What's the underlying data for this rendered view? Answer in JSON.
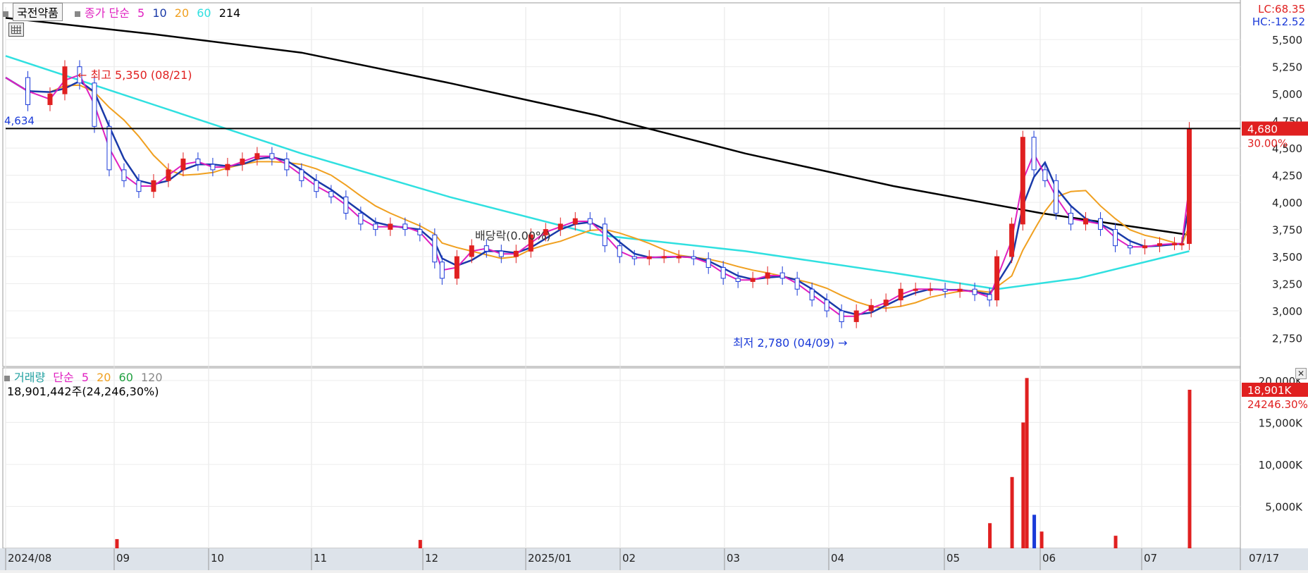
{
  "legend": {
    "stock_name": "국전약품",
    "price_label": "종가 단순",
    "price_ma": [
      {
        "label": "5",
        "color": "#e020c0"
      },
      {
        "label": "10",
        "color": "#1a3aa8"
      },
      {
        "label": "20",
        "color": "#f0a020"
      },
      {
        "label": "60",
        "color": "#30e0e0"
      },
      {
        "label": "214",
        "color": "#000000"
      }
    ],
    "volume_label": "거래량",
    "volume_simple": "단순",
    "volume_ma": [
      {
        "label": "5",
        "color": "#e020c0"
      },
      {
        "label": "20",
        "color": "#f0a020"
      },
      {
        "label": "60",
        "color": "#20a040"
      },
      {
        "label": "120",
        "color": "#888888"
      }
    ],
    "volume_info": "18,901,442주(24,246,30%)",
    "lc": "LC:68.35",
    "hc": "HC:-12.52"
  },
  "chart_data": [
    {
      "type": "candlestick",
      "title": "국전약품",
      "y_ticks": [
        "2,750",
        "3,000",
        "3,250",
        "3,500",
        "3,750",
        "4,000",
        "4,250",
        "4,500",
        "4,750",
        "5,000",
        "5,250",
        "5,500"
      ],
      "ylim": [
        2500,
        5800
      ],
      "x_labels": [
        "2024/08",
        "09",
        "10",
        "11",
        "12",
        "2025/01",
        "02",
        "03",
        "04",
        "05",
        "06",
        "07"
      ],
      "last_date_label": "07/17",
      "current_price": {
        "value": 4680,
        "label": "4,680",
        "change": "30.00%"
      },
      "horizontal_line": {
        "value": 4680,
        "label": "4,634"
      },
      "annotations": [
        {
          "text": "최고 5,350 (08/21)",
          "value": 5350,
          "color": "#e02020"
        },
        {
          "text": "최저 2,780 (04/09)",
          "value": 2780,
          "color": "#1a3ad8"
        },
        {
          "text": "배당락(0.00%)",
          "value": 3800,
          "color": "#333333"
        }
      ],
      "series": [
        {
          "name": "5",
          "color": "#e020c0"
        },
        {
          "name": "10",
          "color": "#1a3aa8"
        },
        {
          "name": "20",
          "color": "#f0a020"
        },
        {
          "name": "60",
          "color": "#30e0e0"
        },
        {
          "name": "214",
          "color": "#000000"
        }
      ],
      "close_approx": [
        {
          "d": 0,
          "v": 5150
        },
        {
          "d": 6,
          "v": 4900
        },
        {
          "d": 12,
          "v": 5000
        },
        {
          "d": 16,
          "v": 5250
        },
        {
          "d": 20,
          "v": 5100
        },
        {
          "d": 24,
          "v": 4700
        },
        {
          "d": 28,
          "v": 4300
        },
        {
          "d": 32,
          "v": 4200
        },
        {
          "d": 36,
          "v": 4100
        },
        {
          "d": 40,
          "v": 4200
        },
        {
          "d": 44,
          "v": 4300
        },
        {
          "d": 48,
          "v": 4400
        },
        {
          "d": 52,
          "v": 4350
        },
        {
          "d": 56,
          "v": 4300
        },
        {
          "d": 60,
          "v": 4350
        },
        {
          "d": 64,
          "v": 4400
        },
        {
          "d": 68,
          "v": 4450
        },
        {
          "d": 72,
          "v": 4400
        },
        {
          "d": 76,
          "v": 4300
        },
        {
          "d": 80,
          "v": 4200
        },
        {
          "d": 84,
          "v": 4100
        },
        {
          "d": 88,
          "v": 4050
        },
        {
          "d": 92,
          "v": 3900
        },
        {
          "d": 96,
          "v": 3800
        },
        {
          "d": 100,
          "v": 3750
        },
        {
          "d": 104,
          "v": 3800
        },
        {
          "d": 108,
          "v": 3750
        },
        {
          "d": 112,
          "v": 3700
        },
        {
          "d": 116,
          "v": 3450
        },
        {
          "d": 118,
          "v": 3300
        },
        {
          "d": 122,
          "v": 3500
        },
        {
          "d": 126,
          "v": 3600
        },
        {
          "d": 130,
          "v": 3550
        },
        {
          "d": 134,
          "v": 3500
        },
        {
          "d": 138,
          "v": 3550
        },
        {
          "d": 142,
          "v": 3700
        },
        {
          "d": 146,
          "v": 3750
        },
        {
          "d": 150,
          "v": 3800
        },
        {
          "d": 154,
          "v": 3850
        },
        {
          "d": 158,
          "v": 3800
        },
        {
          "d": 162,
          "v": 3600
        },
        {
          "d": 166,
          "v": 3500
        },
        {
          "d": 170,
          "v": 3480
        },
        {
          "d": 174,
          "v": 3500
        },
        {
          "d": 178,
          "v": 3500
        },
        {
          "d": 182,
          "v": 3500
        },
        {
          "d": 186,
          "v": 3480
        },
        {
          "d": 190,
          "v": 3400
        },
        {
          "d": 194,
          "v": 3300
        },
        {
          "d": 198,
          "v": 3270
        },
        {
          "d": 202,
          "v": 3300
        },
        {
          "d": 206,
          "v": 3350
        },
        {
          "d": 210,
          "v": 3300
        },
        {
          "d": 214,
          "v": 3200
        },
        {
          "d": 218,
          "v": 3100
        },
        {
          "d": 222,
          "v": 3000
        },
        {
          "d": 226,
          "v": 2900
        },
        {
          "d": 230,
          "v": 3000
        },
        {
          "d": 234,
          "v": 3050
        },
        {
          "d": 238,
          "v": 3100
        },
        {
          "d": 242,
          "v": 3200
        },
        {
          "d": 246,
          "v": 3200
        },
        {
          "d": 250,
          "v": 3200
        },
        {
          "d": 254,
          "v": 3180
        },
        {
          "d": 258,
          "v": 3200
        },
        {
          "d": 262,
          "v": 3150
        },
        {
          "d": 266,
          "v": 3100
        },
        {
          "d": 268,
          "v": 3500
        },
        {
          "d": 272,
          "v": 3800
        },
        {
          "d": 275,
          "v": 4600
        },
        {
          "d": 278,
          "v": 4300
        },
        {
          "d": 281,
          "v": 4200
        },
        {
          "d": 284,
          "v": 3900
        },
        {
          "d": 288,
          "v": 3800
        },
        {
          "d": 292,
          "v": 3850
        },
        {
          "d": 296,
          "v": 3750
        },
        {
          "d": 300,
          "v": 3600
        },
        {
          "d": 304,
          "v": 3580
        },
        {
          "d": 308,
          "v": 3600
        },
        {
          "d": 312,
          "v": 3620
        },
        {
          "d": 316,
          "v": 3620
        },
        {
          "d": 318,
          "v": 3620
        },
        {
          "d": 320,
          "v": 4680
        }
      ],
      "ma214_approx": [
        {
          "d": 0,
          "v": 5700
        },
        {
          "d": 40,
          "v": 5550
        },
        {
          "d": 80,
          "v": 5380
        },
        {
          "d": 120,
          "v": 5100
        },
        {
          "d": 160,
          "v": 4800
        },
        {
          "d": 200,
          "v": 4450
        },
        {
          "d": 240,
          "v": 4150
        },
        {
          "d": 280,
          "v": 3900
        },
        {
          "d": 320,
          "v": 3700
        }
      ],
      "ma60_approx": [
        {
          "d": 0,
          "v": 5350
        },
        {
          "d": 40,
          "v": 4900
        },
        {
          "d": 80,
          "v": 4450
        },
        {
          "d": 120,
          "v": 4050
        },
        {
          "d": 160,
          "v": 3700
        },
        {
          "d": 200,
          "v": 3550
        },
        {
          "d": 240,
          "v": 3350
        },
        {
          "d": 268,
          "v": 3200
        },
        {
          "d": 290,
          "v": 3300
        },
        {
          "d": 320,
          "v": 3550
        }
      ]
    },
    {
      "type": "bar",
      "title": "거래량",
      "y_ticks": [
        "5,000K",
        "10,000K",
        "15,000K",
        "20,000K"
      ],
      "ylim": [
        0,
        21000
      ],
      "current_value": {
        "label": "18,901K",
        "sub": "24246.30%"
      },
      "values_approx": [
        {
          "d": 30,
          "v": 1100
        },
        {
          "d": 112,
          "v": 1000
        },
        {
          "d": 266,
          "v": 3000
        },
        {
          "d": 272,
          "v": 8500
        },
        {
          "d": 275,
          "v": 15000
        },
        {
          "d": 276,
          "v": 20300
        },
        {
          "d": 278,
          "v": 4000
        },
        {
          "d": 280,
          "v": 2000
        },
        {
          "d": 300,
          "v": 1500
        },
        {
          "d": 320,
          "v": 18901
        }
      ]
    }
  ]
}
